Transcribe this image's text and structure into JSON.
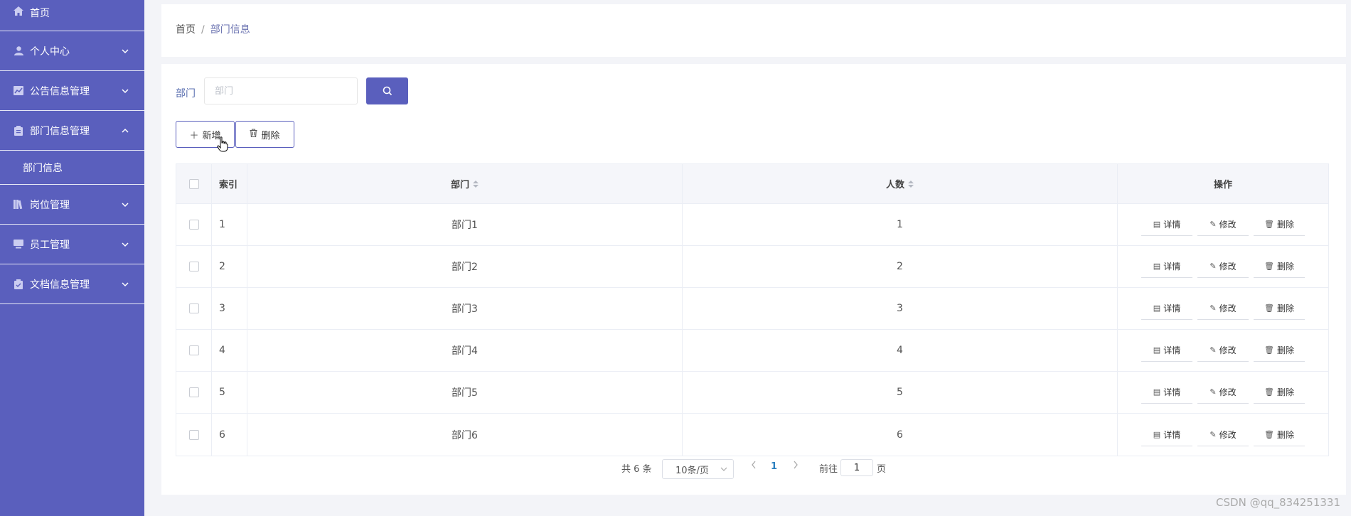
{
  "sidebar": {
    "home": "首页",
    "items": [
      {
        "label": "个人中心",
        "icon": "person-icon"
      },
      {
        "label": "公告信息管理",
        "icon": "chart-icon"
      },
      {
        "label": "部门信息管理",
        "icon": "clipboard-icon",
        "expanded": true,
        "children": [
          "部门信息"
        ]
      },
      {
        "label": "岗位管理",
        "icon": "library-icon"
      },
      {
        "label": "员工管理",
        "icon": "monitor-icon"
      },
      {
        "label": "文档信息管理",
        "icon": "clipboard-icon"
      }
    ]
  },
  "breadcrumb": {
    "home": "首页",
    "separator": "/",
    "current": "部门信息"
  },
  "search": {
    "label": "部门",
    "placeholder": "部门",
    "button_icon": "search-icon"
  },
  "toolbar": {
    "add_label": "新增",
    "delete_label": "删除"
  },
  "table": {
    "headers": {
      "index": "索引",
      "dept": "部门",
      "count": "人数",
      "ops": "操作"
    },
    "rows": [
      {
        "index": "1",
        "dept": "部门1",
        "count": "1"
      },
      {
        "index": "2",
        "dept": "部门2",
        "count": "2"
      },
      {
        "index": "3",
        "dept": "部门3",
        "count": "3"
      },
      {
        "index": "4",
        "dept": "部门4",
        "count": "4"
      },
      {
        "index": "5",
        "dept": "部门5",
        "count": "5"
      },
      {
        "index": "6",
        "dept": "部门6",
        "count": "6"
      }
    ],
    "ops": {
      "detail": "详情",
      "edit": "修改",
      "delete": "删除"
    }
  },
  "pagination": {
    "total": "共 6 条",
    "page_size": "10条/页",
    "current_page": "1",
    "goto_prefix": "前往",
    "goto_value": "1",
    "goto_suffix": "页"
  },
  "watermark": "CSDN @qq_834251331",
  "colors": {
    "sidebar": "#5a5fbd",
    "accent": "#5a5fbd",
    "background": "#f3f4f8"
  }
}
